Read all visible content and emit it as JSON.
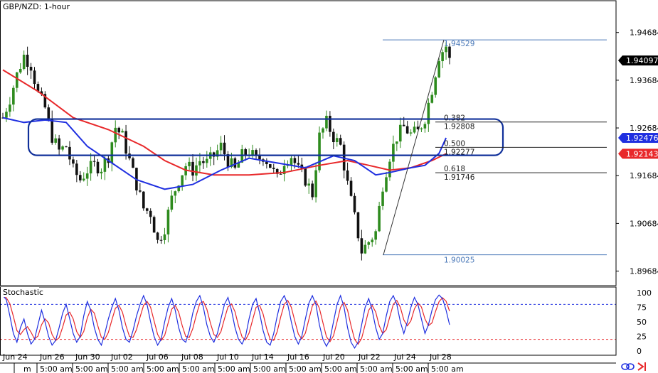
{
  "header": {
    "title": "GBP/NZD: 1-hour"
  },
  "stoch_panel": {
    "title": "Stochastic"
  },
  "chart_data": {
    "type": "candlestick",
    "symbol": "GBP/NZD",
    "timeframe": "1-hour",
    "price_axis": {
      "ticks": [
        "1.94684",
        "1.93684",
        "1.92684",
        "1.91684",
        "1.90684",
        "1.89684"
      ],
      "tick_values": [
        1.94684,
        1.93684,
        1.92684,
        1.91684,
        1.90684,
        1.89684
      ],
      "ylim": [
        1.8938,
        1.9535
      ]
    },
    "price_tags": [
      {
        "label": "1.94097",
        "value": 1.94097,
        "bg": "#000000",
        "fg": "#ffffff"
      },
      {
        "label": "1.92476",
        "value": 1.92476,
        "bg": "#1f2fe0",
        "fg": "#ffffff"
      },
      {
        "label": "1.92143",
        "value": 1.92143,
        "bg": "#e8282a",
        "fg": "#ffffff"
      }
    ],
    "date_labels": [
      "Jun 24",
      "Jun 26",
      "Jun 30",
      "Jul 02",
      "Jul 06",
      "Jul 08",
      "Jul 10",
      "Jul 14",
      "Jul 16",
      "Jul 20",
      "Jul 22",
      "Jul 24",
      "Jul 28"
    ],
    "time_labels": [
      "5:00 am",
      "5:00 am",
      "5:00 am",
      "5:00 am",
      "5:00 am",
      "5:00 am",
      "5:00 am",
      "5:00 am",
      "5:00 am",
      "5:00 am",
      "5:00 am",
      "5:00 am"
    ],
    "time_partial_label": "m",
    "fibonacci": {
      "high_label": "1.94529",
      "high": 1.94529,
      "low_label": "1.90025",
      "low": 1.90025,
      "levels": [
        {
          "ratio": "0.382",
          "value_label": "1.92808",
          "value": 1.92808
        },
        {
          "ratio": "0.500",
          "value_label": "1.92277",
          "value": 1.92277
        },
        {
          "ratio": "0.618",
          "value_label": "1.91746",
          "value": 1.91746
        }
      ]
    },
    "support_zone": {
      "top": 1.9287,
      "bottom": 1.9211,
      "color": "#10309a"
    },
    "close_path": [
      [
        0,
        1.929
      ],
      [
        2,
        1.933
      ],
      [
        4,
        1.938
      ],
      [
        6,
        1.942
      ],
      [
        8,
        1.94
      ],
      [
        10,
        1.934
      ],
      [
        12,
        1.931
      ],
      [
        14,
        1.925
      ],
      [
        16,
        1.922
      ],
      [
        18,
        1.923
      ],
      [
        20,
        1.918
      ],
      [
        22,
        1.916
      ],
      [
        24,
        1.918
      ],
      [
        26,
        1.919
      ],
      [
        28,
        1.9185
      ],
      [
        30,
        1.921
      ],
      [
        32,
        1.927
      ],
      [
        34,
        1.925
      ],
      [
        36,
        1.92
      ],
      [
        38,
        1.915
      ],
      [
        40,
        1.91
      ],
      [
        42,
        1.909
      ],
      [
        44,
        1.903
      ],
      [
        46,
        1.906
      ],
      [
        48,
        1.912
      ],
      [
        50,
        1.916
      ],
      [
        52,
        1.919
      ],
      [
        54,
        1.918
      ],
      [
        56,
        1.92
      ],
      [
        58,
        1.9195
      ],
      [
        60,
        1.921
      ],
      [
        62,
        1.923
      ],
      [
        64,
        1.92
      ],
      [
        66,
        1.918
      ],
      [
        68,
        1.921
      ],
      [
        70,
        1.922
      ],
      [
        72,
        1.92
      ],
      [
        74,
        1.921
      ],
      [
        76,
        1.919
      ],
      [
        78,
        1.916
      ],
      [
        80,
        1.92
      ],
      [
        82,
        1.921
      ],
      [
        84,
        1.918
      ],
      [
        86,
        1.916
      ],
      [
        88,
        1.913
      ],
      [
        90,
        1.925
      ],
      [
        92,
        1.928
      ],
      [
        94,
        1.925
      ],
      [
        96,
        1.923
      ],
      [
        98,
        1.915
      ],
      [
        100,
        1.908
      ],
      [
        102,
        1.901
      ],
      [
        104,
        1.903
      ],
      [
        106,
        1.905
      ],
      [
        108,
        1.915
      ],
      [
        110,
        1.921
      ],
      [
        112,
        1.925
      ],
      [
        114,
        1.927
      ],
      [
        116,
        1.9255
      ],
      [
        118,
        1.926
      ],
      [
        120,
        1.929
      ],
      [
        122,
        1.935
      ],
      [
        124,
        1.942
      ],
      [
        126,
        1.944
      ],
      [
        127,
        1.941
      ]
    ],
    "bar_count": 128,
    "moving_averages": [
      {
        "color": "#e8282a",
        "last_value": 1.92143,
        "path": [
          [
            0,
            1.939
          ],
          [
            10,
            1.9345
          ],
          [
            20,
            1.929
          ],
          [
            30,
            1.9265
          ],
          [
            40,
            1.923
          ],
          [
            46,
            1.92
          ],
          [
            52,
            1.918
          ],
          [
            60,
            1.917
          ],
          [
            70,
            1.917
          ],
          [
            80,
            1.9175
          ],
          [
            90,
            1.919
          ],
          [
            98,
            1.92
          ],
          [
            104,
            1.919
          ],
          [
            110,
            1.918
          ],
          [
            116,
            1.9185
          ],
          [
            122,
            1.92
          ],
          [
            126,
            1.92143
          ]
        ]
      },
      {
        "color": "#1f2fe0",
        "last_value": 1.92476,
        "path": [
          [
            0,
            1.929
          ],
          [
            6,
            1.928
          ],
          [
            12,
            1.9285
          ],
          [
            18,
            1.928
          ],
          [
            24,
            1.923
          ],
          [
            30,
            1.92
          ],
          [
            38,
            1.916
          ],
          [
            46,
            1.914
          ],
          [
            54,
            1.915
          ],
          [
            62,
            1.918
          ],
          [
            70,
            1.9205
          ],
          [
            78,
            1.9195
          ],
          [
            86,
            1.9185
          ],
          [
            94,
            1.921
          ],
          [
            100,
            1.92
          ],
          [
            106,
            1.917
          ],
          [
            110,
            1.9175
          ],
          [
            116,
            1.9185
          ],
          [
            120,
            1.919
          ],
          [
            124,
            1.9215
          ],
          [
            126,
            1.92476
          ]
        ]
      }
    ],
    "stochastic": {
      "ticks": [
        "100",
        "75",
        "50",
        "25",
        "0"
      ],
      "tick_values": [
        100,
        75,
        50,
        25,
        0
      ],
      "ylim": [
        0,
        100
      ],
      "overbought": 80,
      "oversold": 20,
      "k_color": "#1f2fe0",
      "d_color": "#e8282a",
      "k_values": [
        95,
        88,
        60,
        30,
        15,
        40,
        55,
        30,
        12,
        20,
        45,
        70,
        50,
        25,
        10,
        18,
        40,
        65,
        80,
        55,
        30,
        15,
        25,
        60,
        85,
        70,
        40,
        20,
        10,
        30,
        55,
        75,
        90,
        70,
        40,
        20,
        15,
        35,
        60,
        80,
        95,
        80,
        50,
        25,
        10,
        20,
        50,
        75,
        90,
        70,
        40,
        20,
        15,
        35,
        65,
        85,
        95,
        75,
        45,
        25,
        15,
        30,
        55,
        80,
        92,
        70,
        40,
        20,
        12,
        25,
        55,
        80,
        90,
        65,
        35,
        15,
        10,
        30,
        60,
        85,
        95,
        80,
        50,
        25,
        12,
        25,
        55,
        82,
        95,
        80,
        45,
        20,
        8,
        20,
        50,
        80,
        95,
        75,
        40,
        15,
        5,
        15,
        45,
        75,
        90,
        70,
        40,
        20,
        30,
        60,
        85,
        95,
        80,
        50,
        30,
        50,
        75,
        92,
        80,
        55,
        30,
        45,
        70,
        88,
        96,
        90,
        70,
        45
      ]
    }
  }
}
